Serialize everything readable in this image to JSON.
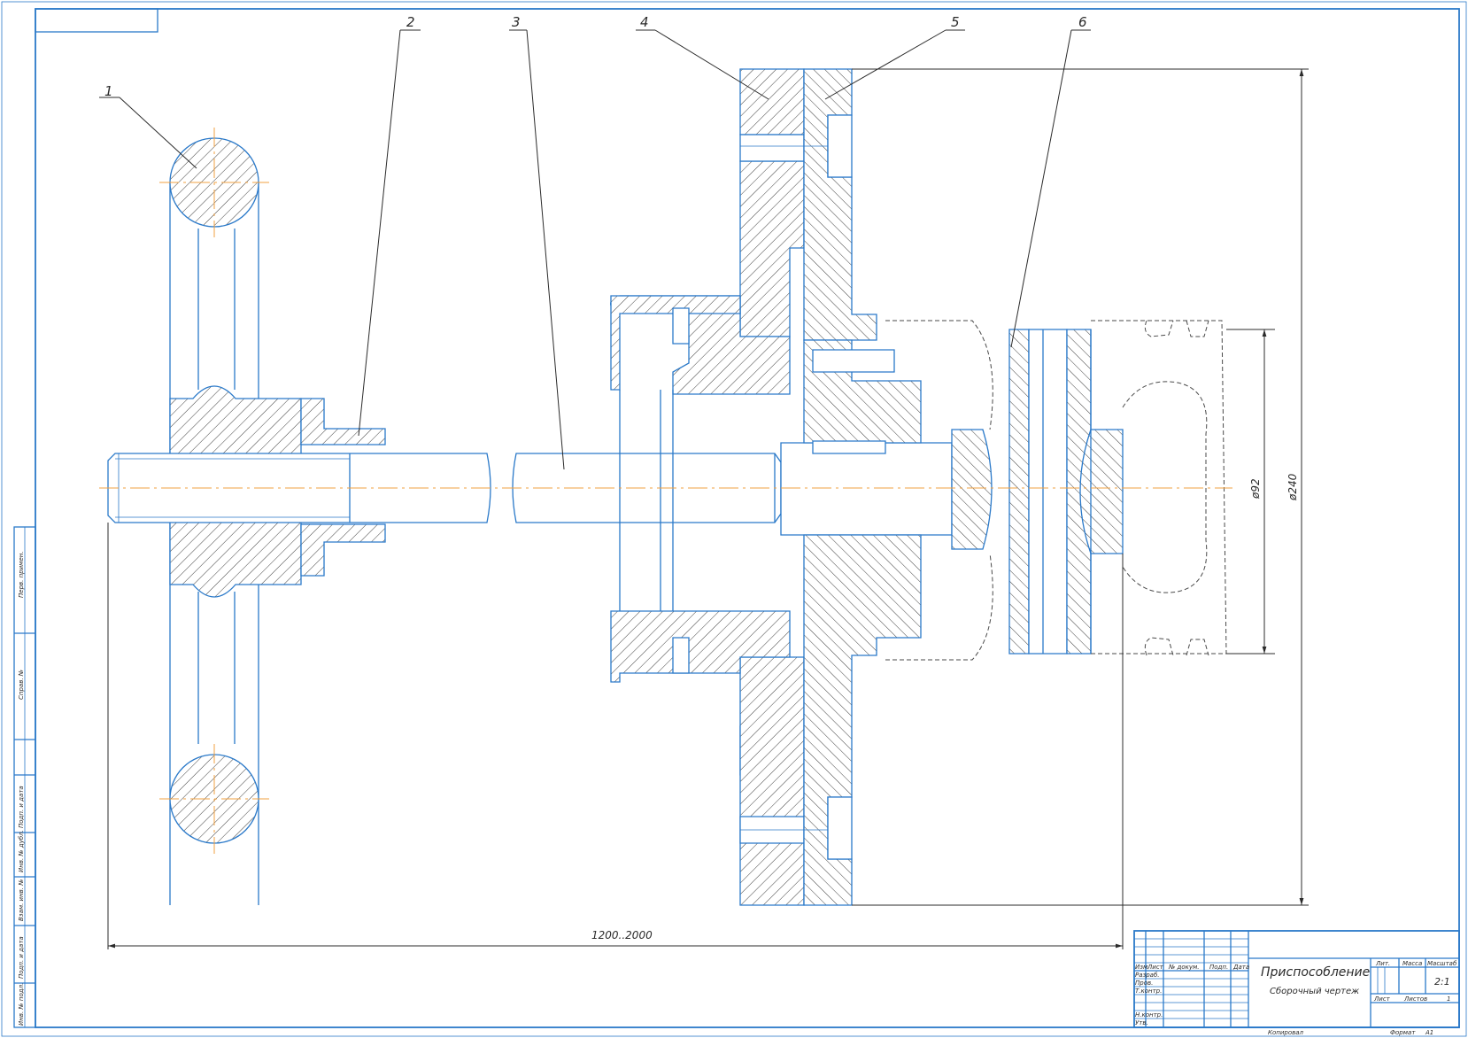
{
  "callouts": [
    "1",
    "2",
    "3",
    "4",
    "5",
    "6"
  ],
  "dimensions": {
    "length": "1200..2000",
    "diameter_inner": "ø92",
    "diameter_outer": "ø240"
  },
  "title_block": {
    "title": "Приспособление",
    "subtitle": "Сборочный чертеж",
    "header_cols": [
      "Изм",
      "Лист",
      "№ докум.",
      "Подп.",
      "Дата"
    ],
    "rows": [
      "Разраб.",
      "Пров.",
      "Т.контр.",
      "Н.контр.",
      "Утв."
    ],
    "lit_label": "Лит.",
    "mass_label": "Масса",
    "scale_label": "Масштаб",
    "scale_value": "2:1",
    "sheet_label": "Лист",
    "sheets_label": "Листов",
    "sheets_value": "1",
    "copied_label": "Копировал",
    "format_label": "Формат",
    "format_value": "А1"
  },
  "side_stamp": [
    "Перв. примен.",
    "Справ. №",
    "Подп. и дата",
    "Инв. № дубл.",
    "Взам. инв. №",
    "Подп. и дата",
    "Инв. № подл."
  ]
}
